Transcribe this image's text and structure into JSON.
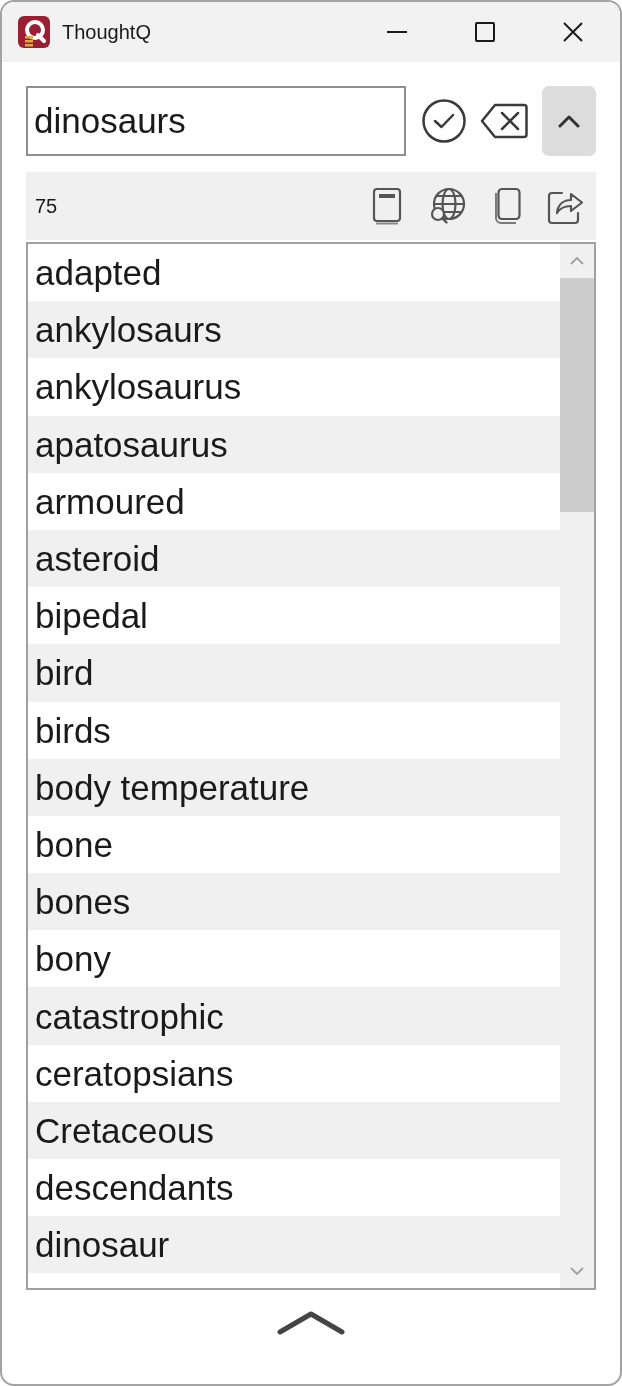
{
  "window": {
    "title": "ThoughtQ"
  },
  "search": {
    "value": "dinosaurs"
  },
  "toolbar": {
    "count": "75"
  },
  "results": [
    "adapted",
    "ankylosaurs",
    "ankylosaurus",
    "apatosaurus",
    "armoured",
    "asteroid",
    "bipedal",
    "bird",
    "birds",
    "body temperature",
    "bone",
    "bones",
    "bony",
    "catastrophic",
    "ceratopsians",
    "Cretaceous",
    "descendants",
    "dinosaur"
  ]
}
